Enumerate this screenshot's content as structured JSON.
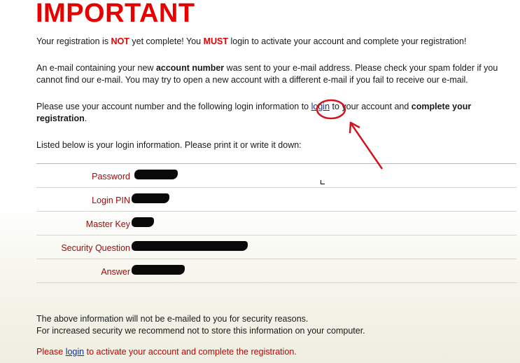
{
  "title": "IMPORTANT",
  "para1": {
    "t1": "Your registration is ",
    "not": "NOT",
    "t2": " yet complete! You ",
    "must": "MUST",
    "t3": " login to activate your account and complete your registration!"
  },
  "para2": {
    "t1": "An e-mail containing your new ",
    "bold": "account number",
    "t2": " was sent to your e-mail address. Please check your spam folder if you cannot find our e-mail. You may try to open a new account with a different e-mail if you fail to receive our e-mail."
  },
  "para3": {
    "t1": "Please use your account number and the following login information to ",
    "link": "login",
    "t2": " to your account and ",
    "bold": "complete your registration",
    "t3": "."
  },
  "para4": "Listed below is your login information. Please print it or write it down:",
  "fields": [
    {
      "label": "Password"
    },
    {
      "label": "Login PIN"
    },
    {
      "label": "Master Key"
    },
    {
      "label": "Security Question"
    },
    {
      "label": "Answer"
    }
  ],
  "footer1": "The above information will not be e-mailed to you for security reasons.",
  "footer2": "For increased security we recommend not to store this information on your computer.",
  "footer3": {
    "t1": "Please ",
    "link": "login",
    "t2": " to activate your account and complete the registration."
  },
  "colors": {
    "accent_red": "#e80000",
    "label_red": "#a00b0b",
    "link_blue": "#0b2f93",
    "annotation_red": "#d0141e"
  }
}
